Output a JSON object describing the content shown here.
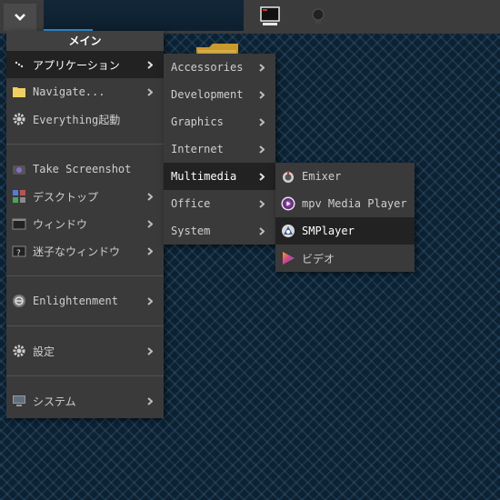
{
  "menus": {
    "main": {
      "title": "メイン",
      "items": [
        {
          "label": "アプリケーション"
        },
        {
          "label": "Navigate..."
        },
        {
          "label": "Everything起動"
        },
        {
          "label": "Take Screenshot"
        },
        {
          "label": "デスクトップ"
        },
        {
          "label": "ウィンドウ"
        },
        {
          "label": "迷子なウィンドウ"
        },
        {
          "label": "Enlightenment"
        },
        {
          "label": "設定"
        },
        {
          "label": "システム"
        }
      ]
    },
    "applications": {
      "items": [
        {
          "label": "Accessories"
        },
        {
          "label": "Development"
        },
        {
          "label": "Graphics"
        },
        {
          "label": "Internet"
        },
        {
          "label": "Multimedia"
        },
        {
          "label": "Office"
        },
        {
          "label": "System"
        }
      ]
    },
    "multimedia": {
      "items": [
        {
          "label": "Emixer"
        },
        {
          "label": "mpv Media Player"
        },
        {
          "label": "SMPlayer"
        },
        {
          "label": "ビデオ"
        }
      ]
    }
  },
  "colors": {
    "menu_bg": "#3a3a3a",
    "selected_bg": "#222222",
    "accent": "#2f8fd8"
  }
}
